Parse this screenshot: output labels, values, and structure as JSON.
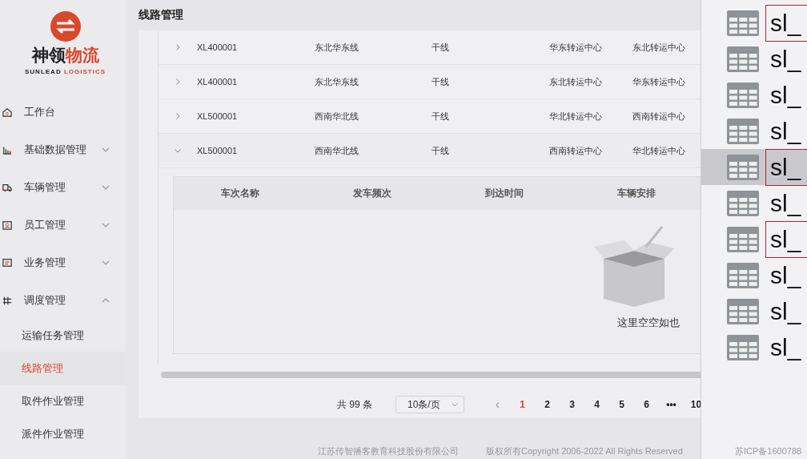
{
  "logo": {
    "name_dark": "神领",
    "name_accent": "物流",
    "subtitle_dark": "SUNLEAD",
    "subtitle_accent": "LOGISTICS"
  },
  "sidebar": {
    "items": [
      {
        "label": "工作台",
        "kind": "link"
      },
      {
        "label": "基础数据管理",
        "kind": "group",
        "expanded": false
      },
      {
        "label": "车辆管理",
        "kind": "group",
        "expanded": false
      },
      {
        "label": "员工管理",
        "kind": "group",
        "expanded": false
      },
      {
        "label": "业务管理",
        "kind": "group",
        "expanded": false
      },
      {
        "label": "调度管理",
        "kind": "group",
        "expanded": true,
        "children": [
          {
            "label": "运输任务管理",
            "selected": false
          },
          {
            "label": "线路管理",
            "selected": true
          },
          {
            "label": "取件作业管理",
            "selected": false
          },
          {
            "label": "派件作业管理",
            "selected": false
          }
        ]
      }
    ]
  },
  "page_title": "线路管理",
  "table": {
    "rows": [
      {
        "expanded": false,
        "code": "XL400001",
        "name": "东北华东线",
        "type": "干线",
        "start": "华东转运中心",
        "end": "东北转运中心"
      },
      {
        "expanded": false,
        "code": "XL400001",
        "name": "东北华东线",
        "type": "干线",
        "start": "东北转运中心",
        "end": "华东转运中心"
      },
      {
        "expanded": false,
        "code": "XL500001",
        "name": "西南华北线",
        "type": "干线",
        "start": "华北转运中心",
        "end": "西南转运中心"
      },
      {
        "expanded": true,
        "code": "XL500001",
        "name": "西南华北线",
        "type": "干线",
        "start": "西南转运中心",
        "end": "华北转运中心"
      }
    ],
    "sub_table": {
      "columns": [
        "车次名称",
        "发车频次",
        "到达时间",
        "车辆安排"
      ],
      "empty_text": "这里空空如也"
    }
  },
  "pagination": {
    "total": "共 99 条",
    "page_size": "10条/页",
    "prev": "‹",
    "pages": [
      {
        "label": "1",
        "selected": true
      },
      {
        "label": "2",
        "selected": false
      },
      {
        "label": "3",
        "selected": false
      },
      {
        "label": "4",
        "selected": false
      },
      {
        "label": "5",
        "selected": false
      },
      {
        "label": "6",
        "selected": false
      },
      {
        "label": "•••",
        "selected": false
      },
      {
        "label": "10",
        "selected": false
      }
    ]
  },
  "footer": {
    "company": "江苏传智播客教育科技股份有限公司",
    "copyright": "版权所有Copyright 2006-2022 All Rights Reserved",
    "icp": "苏ICP备1600788"
  },
  "side_panel": {
    "items": [
      {
        "label": "sl_",
        "selected": false,
        "highlighted": true
      },
      {
        "label": "sl_",
        "selected": false,
        "highlighted": false
      },
      {
        "label": "sl_",
        "selected": false,
        "highlighted": false
      },
      {
        "label": "sl_",
        "selected": false,
        "highlighted": false
      },
      {
        "label": "sl_",
        "selected": true,
        "highlighted": true
      },
      {
        "label": "sl_",
        "selected": false,
        "highlighted": false
      },
      {
        "label": "sl_",
        "selected": false,
        "highlighted": true
      },
      {
        "label": "sl_",
        "selected": false,
        "highlighted": false
      },
      {
        "label": "sl_",
        "selected": false,
        "highlighted": false
      },
      {
        "label": "sl_",
        "selected": false,
        "highlighted": false
      }
    ]
  }
}
